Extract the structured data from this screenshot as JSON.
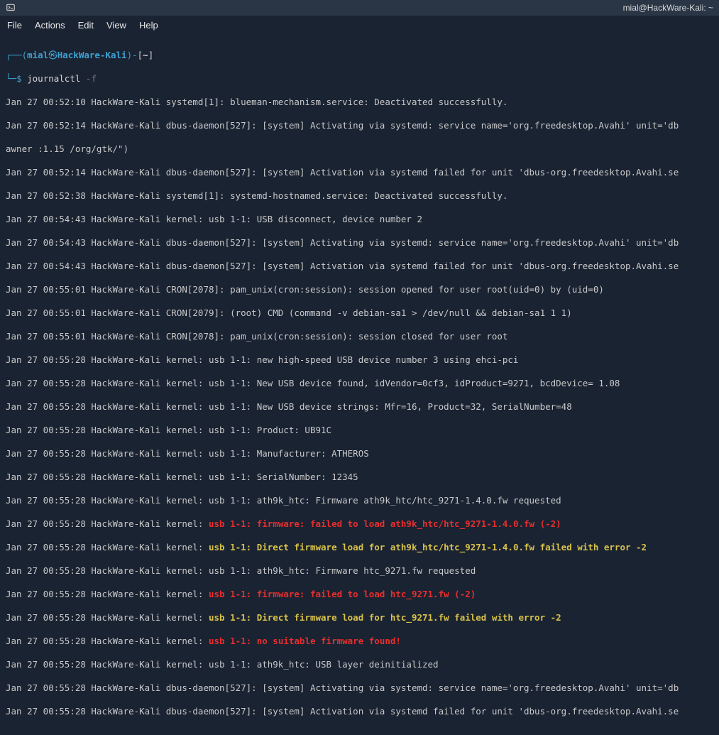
{
  "window": {
    "title": "mial@HackWare-Kali: ~"
  },
  "menu": {
    "file": "File",
    "actions": "Actions",
    "edit": "Edit",
    "view": "View",
    "help": "Help"
  },
  "prompt": {
    "corner1": "┌──",
    "open_paren": "(",
    "user": "mial",
    "at": "㉿",
    "host": "HackWare-Kali",
    "close_paren": ")",
    "dash": "-",
    "lbracket": "[",
    "cwd": "~",
    "rbracket": "]",
    "corner2": "└─",
    "dollar": "$"
  },
  "command": {
    "bin": "journalctl",
    "flag": "-f"
  },
  "lines": {
    "l0": "Jan 27 00:52:10 HackWare-Kali systemd[1]: blueman-mechanism.service: Deactivated successfully.",
    "l1": "Jan 27 00:52:14 HackWare-Kali dbus-daemon[527]: [system] Activating via systemd: service name='org.freedesktop.Avahi' unit='db",
    "l2": "awner :1.15 /org/gtk/\")",
    "l3": "Jan 27 00:52:14 HackWare-Kali dbus-daemon[527]: [system] Activation via systemd failed for unit 'dbus-org.freedesktop.Avahi.se",
    "l4": "Jan 27 00:52:38 HackWare-Kali systemd[1]: systemd-hostnamed.service: Deactivated successfully.",
    "l5": "Jan 27 00:54:43 HackWare-Kali kernel: usb 1-1: USB disconnect, device number 2",
    "l6": "Jan 27 00:54:43 HackWare-Kali dbus-daemon[527]: [system] Activating via systemd: service name='org.freedesktop.Avahi' unit='db",
    "l7": "Jan 27 00:54:43 HackWare-Kali dbus-daemon[527]: [system] Activation via systemd failed for unit 'dbus-org.freedesktop.Avahi.se",
    "l8": "Jan 27 00:55:01 HackWare-Kali CRON[2078]: pam_unix(cron:session): session opened for user root(uid=0) by (uid=0)",
    "l9": "Jan 27 00:55:01 HackWare-Kali CRON[2079]: (root) CMD (command -v debian-sa1 > /dev/null && debian-sa1 1 1)",
    "l10": "Jan 27 00:55:01 HackWare-Kali CRON[2078]: pam_unix(cron:session): session closed for user root",
    "l11": "Jan 27 00:55:28 HackWare-Kali kernel: usb 1-1: new high-speed USB device number 3 using ehci-pci",
    "l12": "Jan 27 00:55:28 HackWare-Kali kernel: usb 1-1: New USB device found, idVendor=0cf3, idProduct=9271, bcdDevice= 1.08",
    "l13": "Jan 27 00:55:28 HackWare-Kali kernel: usb 1-1: New USB device strings: Mfr=16, Product=32, SerialNumber=48",
    "l14": "Jan 27 00:55:28 HackWare-Kali kernel: usb 1-1: Product: UB91C",
    "l15": "Jan 27 00:55:28 HackWare-Kali kernel: usb 1-1: Manufacturer: ATHEROS",
    "l16": "Jan 27 00:55:28 HackWare-Kali kernel: usb 1-1: SerialNumber: 12345",
    "l17": "Jan 27 00:55:28 HackWare-Kali kernel: usb 1-1: ath9k_htc: Firmware ath9k_htc/htc_9271-1.4.0.fw requested",
    "l18p": "Jan 27 00:55:28 HackWare-Kali kernel: ",
    "l18e": "usb 1-1: firmware: failed to load ath9k_htc/htc_9271-1.4.0.fw (-2)",
    "l19p": "Jan 27 00:55:28 HackWare-Kali kernel: ",
    "l19w": "usb 1-1: Direct firmware load for ath9k_htc/htc_9271-1.4.0.fw failed with error -2",
    "l20": "Jan 27 00:55:28 HackWare-Kali kernel: usb 1-1: ath9k_htc: Firmware htc_9271.fw requested",
    "l21p": "Jan 27 00:55:28 HackWare-Kali kernel: ",
    "l21e": "usb 1-1: firmware: failed to load htc_9271.fw (-2)",
    "l22p": "Jan 27 00:55:28 HackWare-Kali kernel: ",
    "l22w": "usb 1-1: Direct firmware load for htc_9271.fw failed with error -2",
    "l23p": "Jan 27 00:55:28 HackWare-Kali kernel: ",
    "l23e": "usb 1-1: no suitable firmware found!",
    "l24": "Jan 27 00:55:28 HackWare-Kali kernel: usb 1-1: ath9k_htc: USB layer deinitialized",
    "l25": "Jan 27 00:55:28 HackWare-Kali dbus-daemon[527]: [system] Activating via systemd: service name='org.freedesktop.Avahi' unit='db",
    "l26": "Jan 27 00:55:28 HackWare-Kali dbus-daemon[527]: [system] Activation via systemd failed for unit 'dbus-org.freedesktop.Avahi.se"
  }
}
